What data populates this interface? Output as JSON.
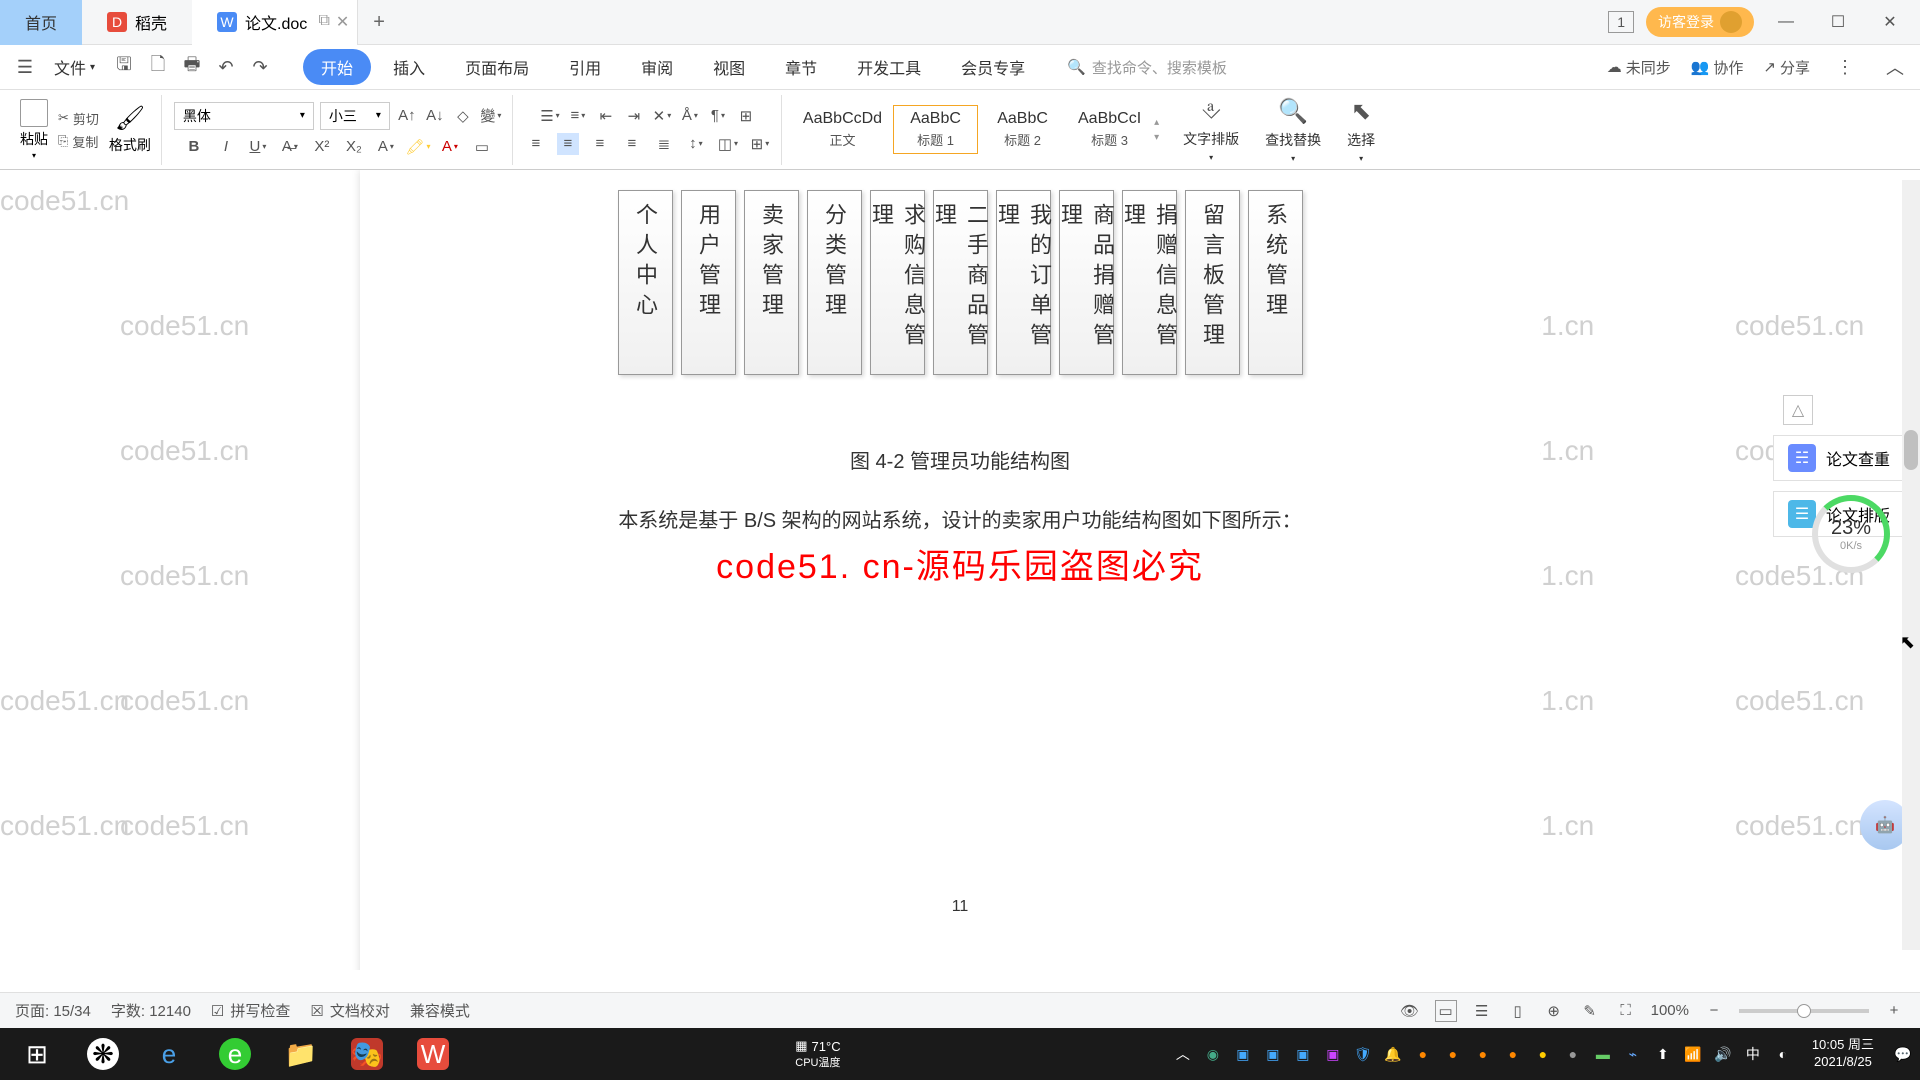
{
  "tabs": {
    "home": "首页",
    "daoke": "稻壳",
    "doc": "论文.doc"
  },
  "titlebar": {
    "login": "访客登录",
    "badge": "1"
  },
  "menu": {
    "file": "文件",
    "items": [
      "开始",
      "插入",
      "页面布局",
      "引用",
      "审阅",
      "视图",
      "章节",
      "开发工具",
      "会员专享"
    ],
    "search_placeholder": "查找命令、搜索模板",
    "unsync": "未同步",
    "collab": "协作",
    "share": "分享"
  },
  "ribbon": {
    "paste": "粘贴",
    "cut": "剪切",
    "copy": "复制",
    "format_painter": "格式刷",
    "font": "黑体",
    "size": "小三",
    "styles": [
      {
        "preview": "AaBbCcDd",
        "label": "正文"
      },
      {
        "preview": "AaBbC",
        "label": "标题 1"
      },
      {
        "preview": "AaBbC",
        "label": "标题 2"
      },
      {
        "preview": "AaBbCcI",
        "label": "标题 3"
      }
    ],
    "text_layout": "文字排版",
    "find_replace": "查找替换",
    "select": "选择"
  },
  "document": {
    "boxes": [
      "个人中心",
      "用户管理",
      "卖家管理",
      "分类管理",
      "求购信息管理",
      "二手商品管理",
      "我的订单管理",
      "商品捐赠管理",
      "捐赠信息管理",
      "留言板管理",
      "系统管理"
    ],
    "caption": "图 4-2 管理员功能结构图",
    "body": "本系统是基于 B/S 架构的网站系统，设计的卖家用户功能结构图如下图所示：",
    "red_watermark": "code51. cn-源码乐园盗图必究",
    "page_num": "11",
    "watermark": "code51.cn"
  },
  "panel": {
    "btn1": "论文查重",
    "btn2": "论文排版",
    "progress_pct": "23%",
    "progress_speed": "0K/s"
  },
  "statusbar": {
    "page": "页面: 15/34",
    "words": "字数: 12140",
    "spell": "拼写检查",
    "doc_check": "文档校对",
    "compat": "兼容模式",
    "zoom": "100%"
  },
  "taskbar": {
    "temp": "71°C",
    "temp_label": "CPU温度",
    "time": "10:05",
    "day": "周三",
    "date": "2021/8/25"
  }
}
